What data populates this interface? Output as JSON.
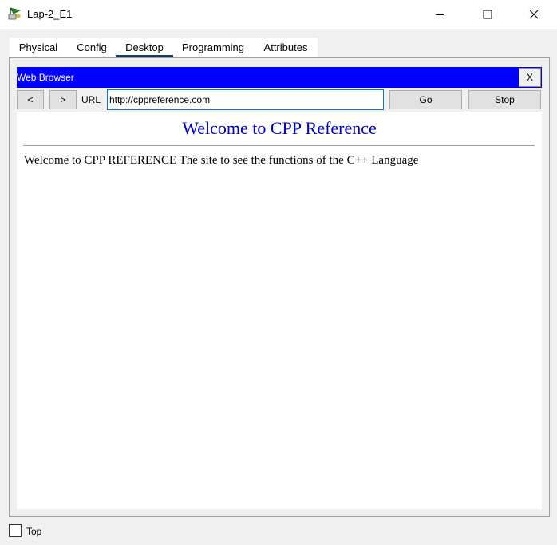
{
  "window": {
    "title": "Lap-2_E1",
    "app_icon": "packet-tracer-laptop-icon",
    "controls": [
      "minimize-icon",
      "maximize-icon",
      "close-icon"
    ]
  },
  "tabs": [
    {
      "label": "Physical"
    },
    {
      "label": "Config"
    },
    {
      "label": "Desktop",
      "active": true
    },
    {
      "label": "Programming"
    },
    {
      "label": "Attributes"
    }
  ],
  "browser": {
    "title": "Web Browser",
    "close_label": "X",
    "back_label": "<",
    "forward_label": ">",
    "url_label": "URL",
    "url_value": "http://cppreference.com",
    "go_label": "Go",
    "stop_label": "Stop",
    "header_color": "#0000ff"
  },
  "page": {
    "heading": "Welcome to CPP Reference",
    "body": "Welcome to CPP REFERENCE The site to see the functions of the C++ Language",
    "heading_color": "#0000cc"
  },
  "footer": {
    "top_label": "Top",
    "top_checked": false
  }
}
